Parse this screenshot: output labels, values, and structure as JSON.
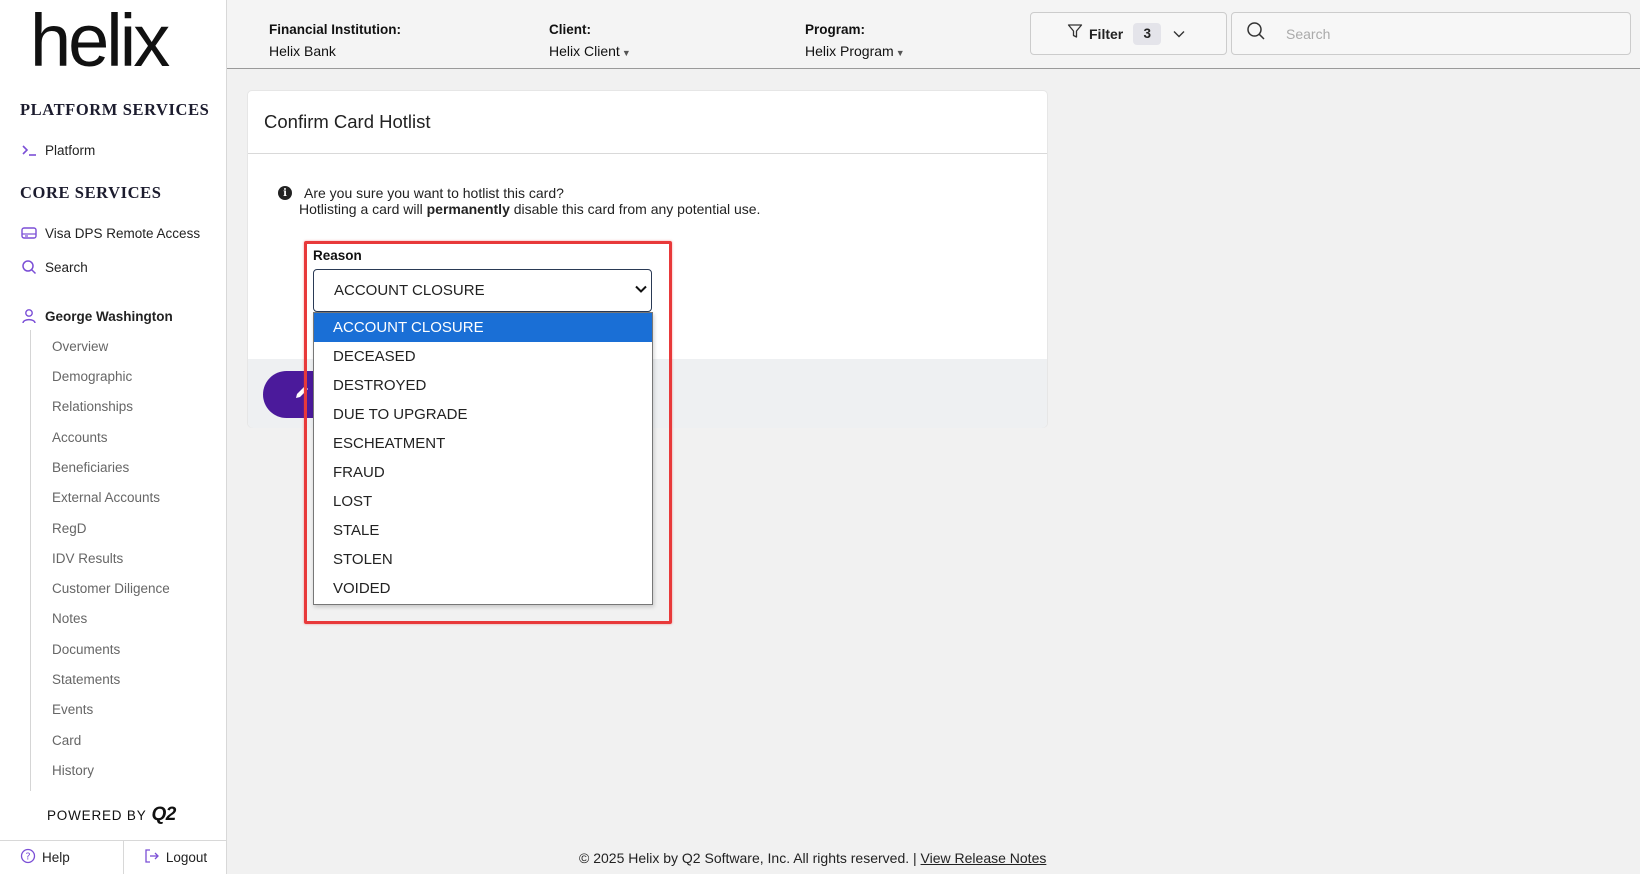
{
  "sidebar": {
    "logo": "helix",
    "platform_services_title": "PLATFORM SERVICES",
    "platform_item": "Platform",
    "core_services_title": "CORE SERVICES",
    "core_items": [
      "Visa DPS Remote Access",
      "Search"
    ],
    "person": "George Washington",
    "sub_items": [
      "Overview",
      "Demographic",
      "Relationships",
      "Accounts",
      "Beneficiaries",
      "External Accounts",
      "RegD",
      "IDV Results",
      "Customer Diligence",
      "Notes",
      "Documents",
      "Statements",
      "Events",
      "Card",
      "History"
    ],
    "powered_by": "POWERED BY",
    "powered_brand": "Q2",
    "help": "Help",
    "logout": "Logout"
  },
  "topbar": {
    "fi_label": "Financial Institution:",
    "fi_value": "Helix Bank",
    "client_label": "Client:",
    "client_value": "Helix Client",
    "program_label": "Program:",
    "program_value": "Helix Program",
    "filter_label": "Filter",
    "filter_count": "3",
    "search_placeholder": "Search"
  },
  "dialog": {
    "title": "Confirm Card Hotlist",
    "question": "Are you sure you want to hotlist this card?",
    "warning_pre": "Hotlisting a card will ",
    "warning_bold": "permanently",
    "warning_post": " disable this card from any potential use.",
    "reason_label": "Reason",
    "reason_selected": "ACCOUNT CLOSURE",
    "reason_options": [
      "ACCOUNT CLOSURE",
      "DECEASED",
      "DESTROYED",
      "DUE TO UPGRADE",
      "ESCHEATMENT",
      "FRAUD",
      "LOST",
      "STALE",
      "STOLEN",
      "VOIDED"
    ]
  },
  "footer": {
    "copyright": "© 2025 Helix by Q2 Software, Inc. All rights reserved. | ",
    "release_notes": "View Release Notes"
  },
  "colors": {
    "accent": "#7b4fd6",
    "primary_button": "#4b1a9b",
    "selected_option": "#1a6fd6",
    "highlight_border": "#e8393a"
  }
}
